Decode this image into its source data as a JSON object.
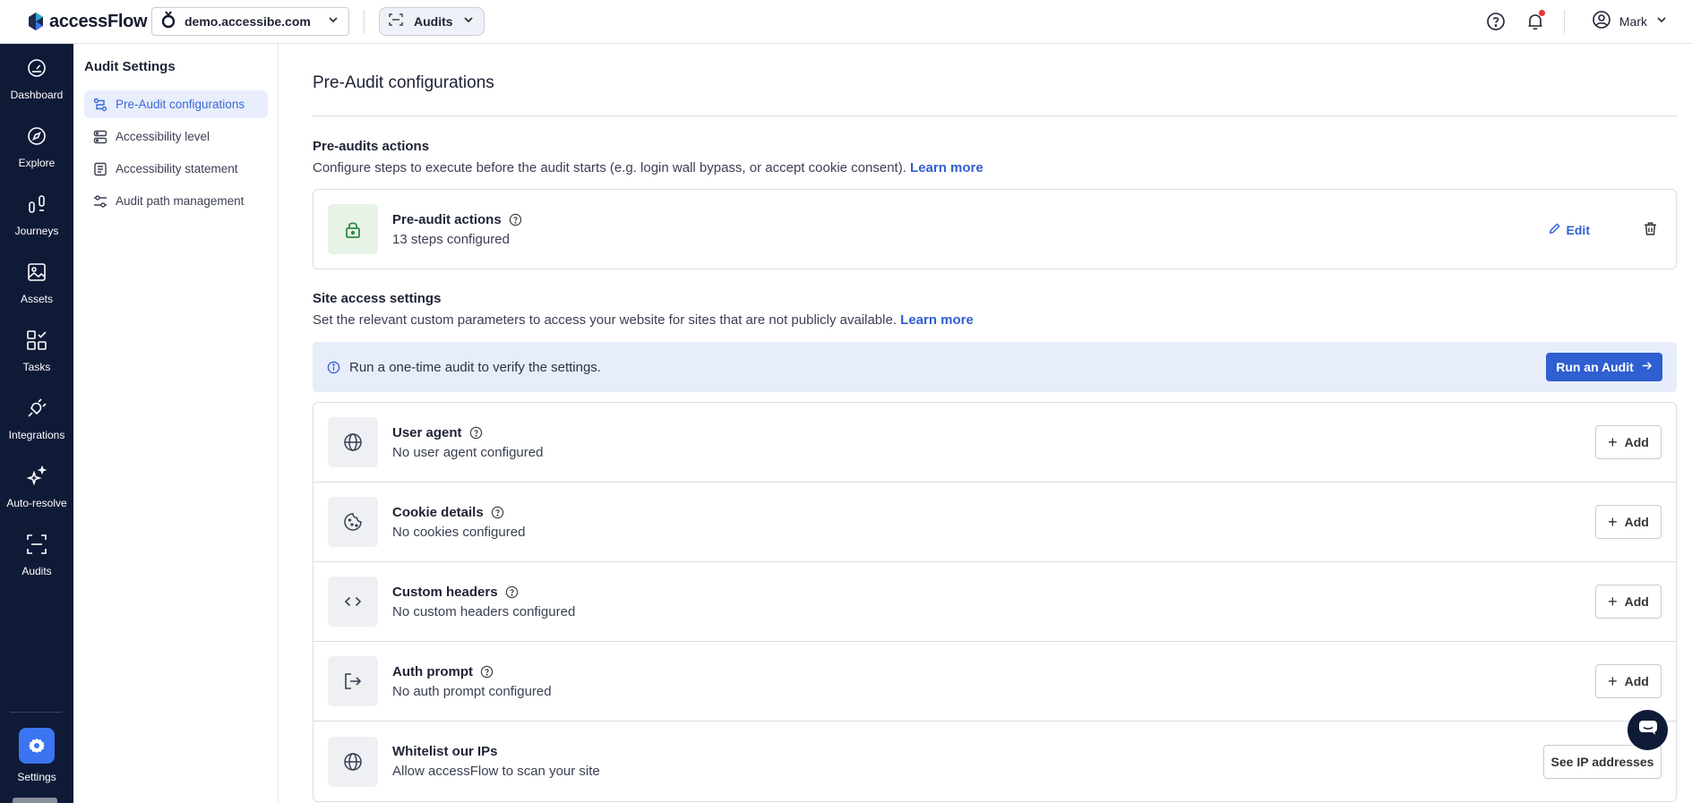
{
  "topbar": {
    "brand": "accessFlow",
    "site": "demo.accessibe.com",
    "product": "Audits",
    "user": "Mark"
  },
  "nav": [
    {
      "label": "Dashboard",
      "icon": "gauge-icon"
    },
    {
      "label": "Explore",
      "icon": "compass-icon"
    },
    {
      "label": "Journeys",
      "icon": "journey-icon"
    },
    {
      "label": "Assets",
      "icon": "image-icon"
    },
    {
      "label": "Tasks",
      "icon": "tasks-icon"
    },
    {
      "label": "Integrations",
      "icon": "plug-icon"
    },
    {
      "label": "Auto-resolve",
      "icon": "sparkle-icon"
    },
    {
      "label": "Audits",
      "icon": "scan-icon"
    },
    {
      "label": "Settings",
      "icon": "gear-icon"
    }
  ],
  "submenu": {
    "title": "Audit Settings",
    "items": [
      {
        "label": "Pre-Audit configurations",
        "active": true
      },
      {
        "label": "Accessibility level"
      },
      {
        "label": "Accessibility statement"
      },
      {
        "label": "Audit path management"
      }
    ]
  },
  "main": {
    "title": "Pre-Audit configurations",
    "pre_audits": {
      "title": "Pre-audits actions",
      "desc": "Configure steps to execute before the audit starts (e.g. login wall bypass, or accept cookie consent).",
      "learn_more": "Learn more",
      "card": {
        "title": "Pre-audit actions",
        "subtitle": "13 steps configured",
        "edit_label": "Edit"
      }
    },
    "site_access": {
      "title": "Site access settings",
      "desc": "Set the relevant custom parameters to access your website for sites that are not publicly available.",
      "learn_more": "Learn more",
      "info": "Run a one-time audit to verify the settings.",
      "run_label": "Run an Audit",
      "rows": [
        {
          "title": "User agent",
          "subtitle": "No user agent configured",
          "action": "Add"
        },
        {
          "title": "Cookie details",
          "subtitle": "No cookies configured",
          "action": "Add"
        },
        {
          "title": "Custom headers",
          "subtitle": "No custom headers configured",
          "action": "Add"
        },
        {
          "title": "Auth prompt",
          "subtitle": "No auth prompt configured",
          "action": "Add"
        },
        {
          "title": "Whitelist our IPs",
          "subtitle": "Allow accessFlow to scan your site",
          "action": "See IP addresses"
        }
      ]
    }
  },
  "colors": {
    "nav_bg": "#0f1a37",
    "accent": "#2f5fd0",
    "info_bg": "#e7edfb",
    "lock_green": "#2e8b3e"
  }
}
